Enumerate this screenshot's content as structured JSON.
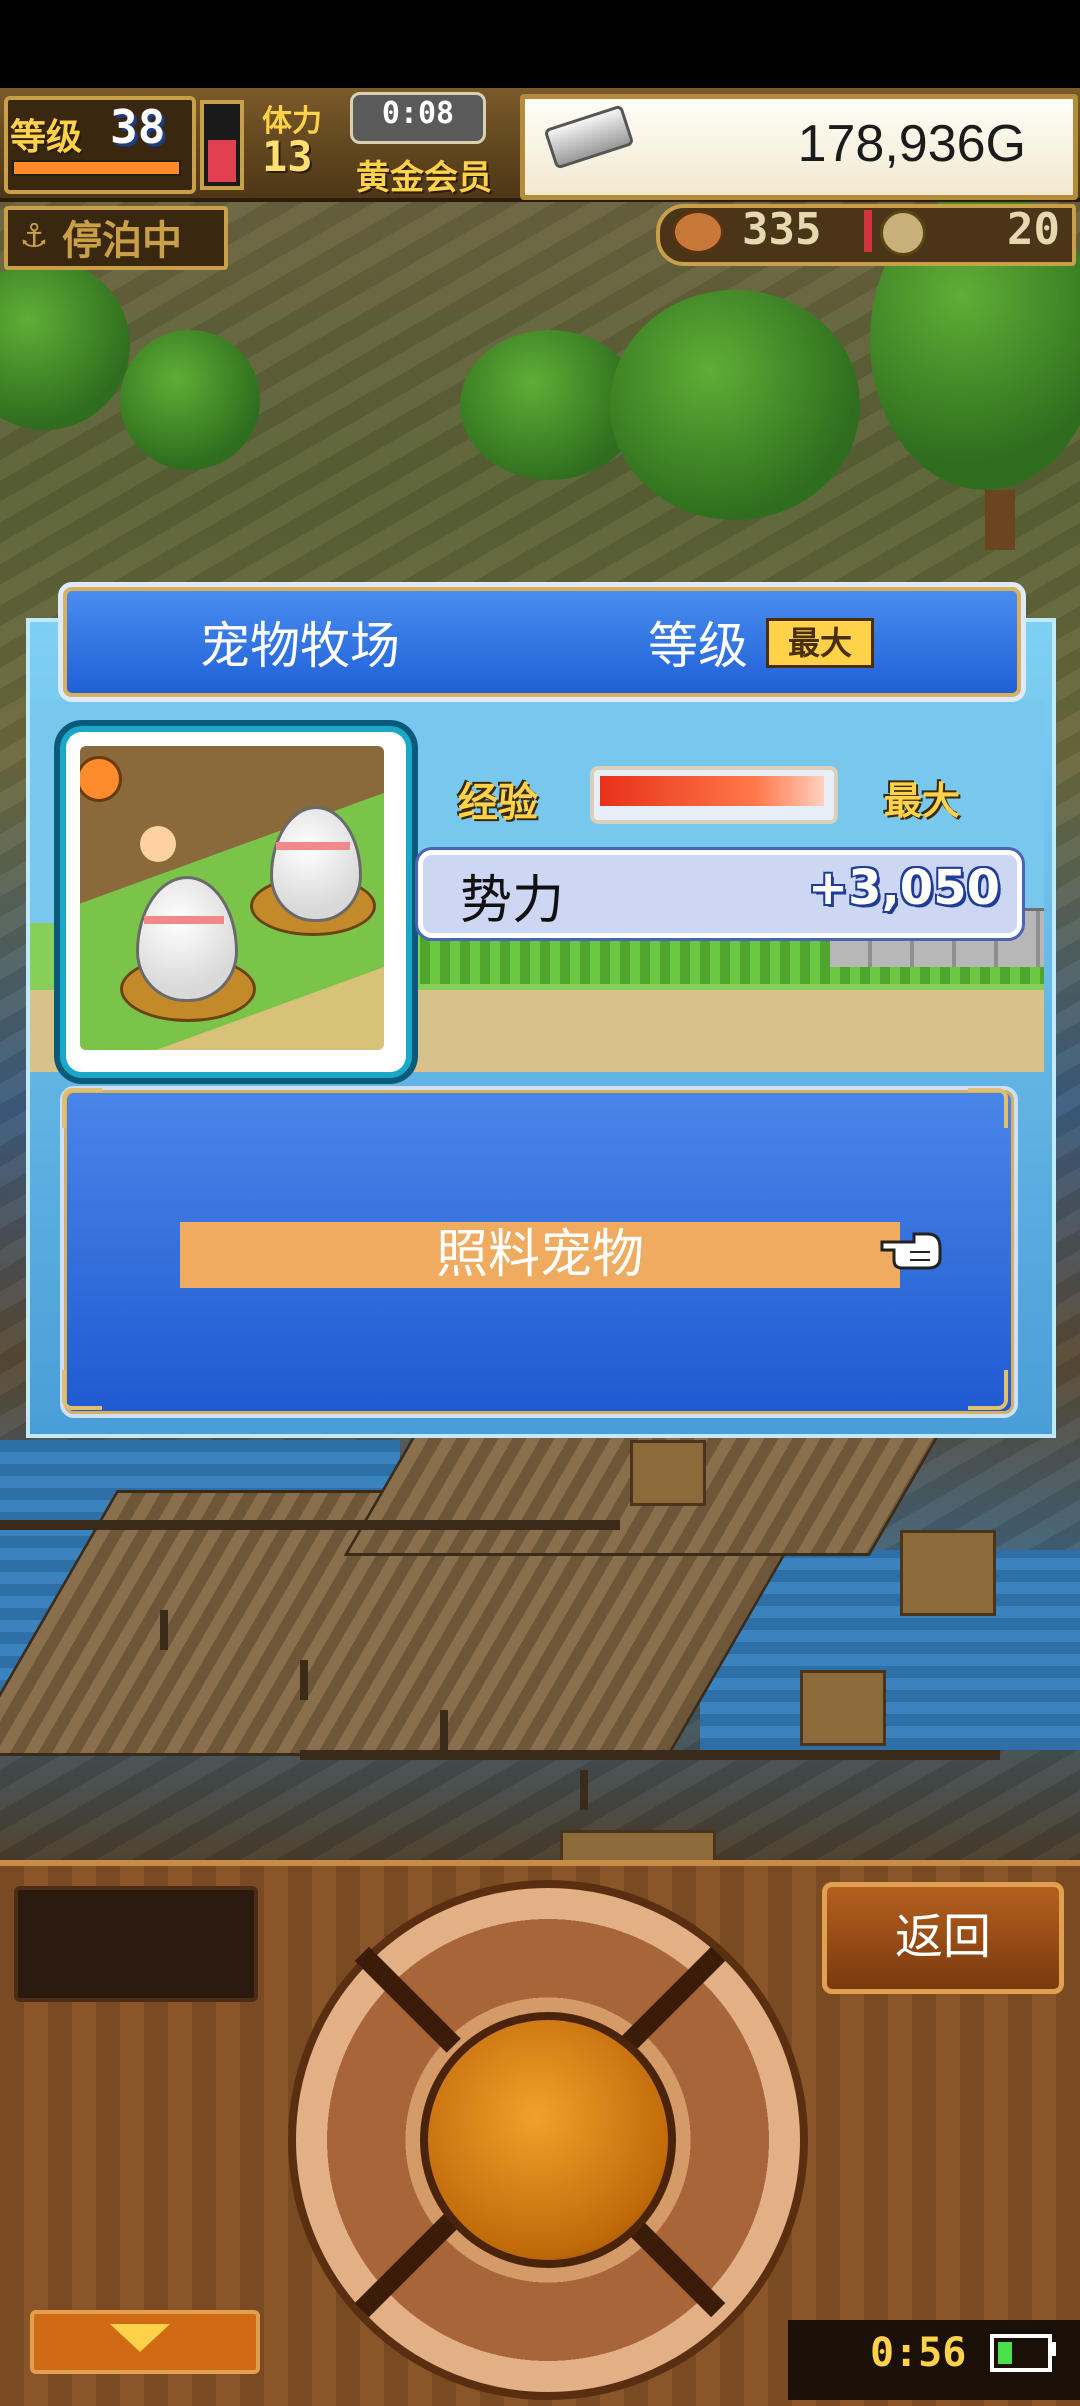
{
  "hud": {
    "level_label": "等级",
    "level_value": "38",
    "stamina_label": "体力",
    "stamina_value": "13",
    "timer": "0:08",
    "member_label": "黄金会员",
    "gold": "178,936G",
    "docked_label": "停泊中",
    "food_value": "335",
    "coin_value": "20"
  },
  "dialog": {
    "title": "宠物牧场",
    "level_caption": "等级",
    "level_value": "最大",
    "exp_label": "经验",
    "exp_value": "最大",
    "exp_progress": 1.0,
    "power_label": "势力",
    "power_value": "+3,050",
    "feed_button": "照料宠物"
  },
  "controls": {
    "back_button": "返回",
    "clock": "0:56"
  },
  "icons": {
    "anchor": "anchor-icon",
    "food": "roast-meat-icon",
    "coin": "coin-icon",
    "gold": "silver-ingot-icon",
    "pointer": "pointing-hand-icon",
    "down": "down-arrow-icon",
    "battery": "battery-icon"
  },
  "colors": {
    "dialog_blue": "#1f5fd6",
    "accent_gold": "#ffd24a",
    "feed_button": "#efac60",
    "wood": "#7a4a22"
  }
}
